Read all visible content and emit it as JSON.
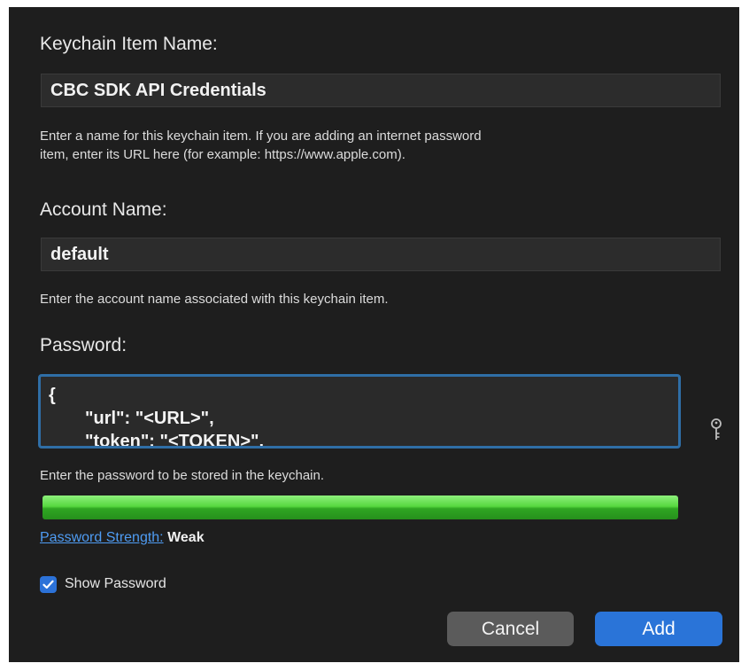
{
  "item_name": {
    "label": "Keychain Item Name:",
    "value": "CBC SDK API Credentials",
    "help_line1": "Enter a name for this keychain item. If you are adding an internet password",
    "help_line2": "item, enter its URL here (for example: https://www.apple.com)."
  },
  "account": {
    "label": "Account Name:",
    "value": "default",
    "help": "Enter the account name associated with this keychain item."
  },
  "password": {
    "label": "Password:",
    "lines": [
      "{",
      "\"url\": \"<URL>\",",
      "\"token\": \"<TOKEN>\","
    ],
    "help": "Enter the password to be stored in the keychain."
  },
  "strength": {
    "link_label": "Password Strength:",
    "value": "Weak",
    "level": 1.0
  },
  "show_password": {
    "label": "Show Password",
    "checked": true
  },
  "buttons": {
    "cancel": "Cancel",
    "add": "Add"
  },
  "colors": {
    "accent": "#2a74d8",
    "link": "#4f9cf3",
    "strength": "#57d840"
  },
  "icons": {
    "key": "key-icon",
    "check": "checkmark-icon"
  }
}
